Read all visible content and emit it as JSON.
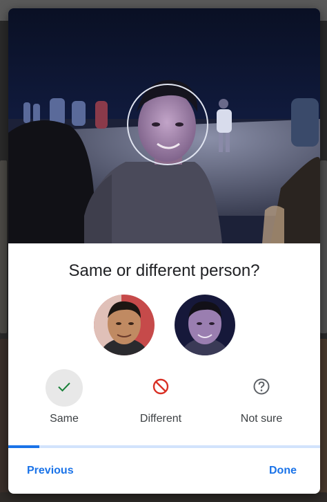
{
  "dialog": {
    "question": "Same or different person?",
    "options": [
      {
        "label": "Same",
        "icon": "check-icon",
        "selected": true,
        "color": "#188038"
      },
      {
        "label": "Different",
        "icon": "block-icon",
        "selected": false,
        "color": "#d93025"
      },
      {
        "label": "Not sure",
        "icon": "help-circle-icon",
        "selected": false,
        "color": "#5f6368"
      }
    ],
    "progress": 0.1,
    "previous_label": "Previous",
    "done_label": "Done"
  },
  "colors": {
    "accent": "#1a73e8",
    "progress_track": "#d2e3fc",
    "selected_bg": "#e8e8e8"
  }
}
